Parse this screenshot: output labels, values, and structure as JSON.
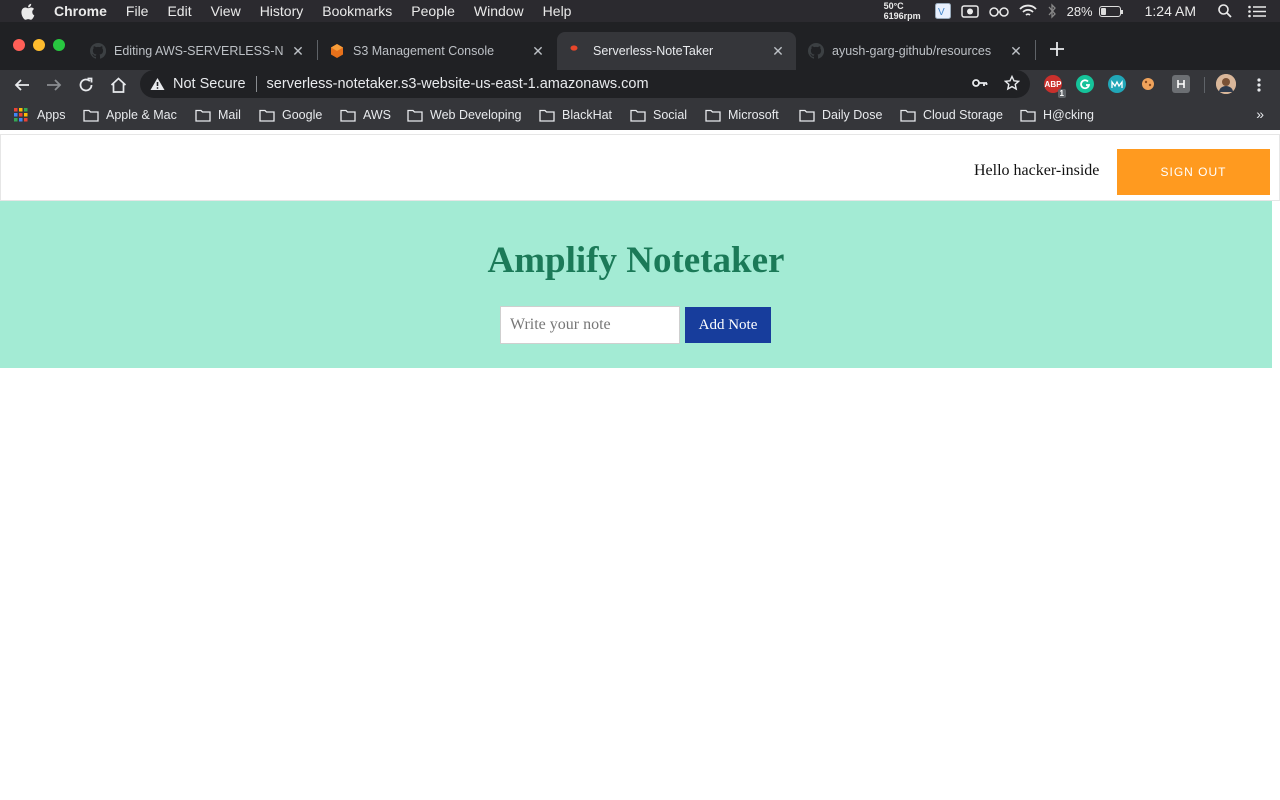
{
  "menubar": {
    "app_name": "Chrome",
    "items": [
      "File",
      "Edit",
      "View",
      "History",
      "Bookmarks",
      "People",
      "Window",
      "Help"
    ],
    "temperature": "50°C",
    "fan_speed": "6196rpm",
    "battery_percent": "28%",
    "battery_level": 0.28,
    "time": "1:24 AM"
  },
  "tabs": [
    {
      "title": "Editing AWS-SERVERLESS-NO",
      "icon": "github-icon",
      "active": false
    },
    {
      "title": "S3 Management Console",
      "icon": "aws-s3-icon",
      "active": false
    },
    {
      "title": "Serverless-NoteTaker",
      "icon": "red-dot-icon",
      "active": true
    },
    {
      "title": "ayush-garg-github/resources",
      "icon": "github-icon",
      "active": false
    }
  ],
  "omnibox": {
    "security_label": "Not Secure",
    "url": "serverless-notetaker.s3-website-us-east-1.amazonaws.com"
  },
  "extensions": {
    "adblock_badge": "1",
    "adblock_label": "ABP"
  },
  "bookmarks": [
    "Apps",
    "Apple & Mac",
    "Mail",
    "Google",
    "AWS",
    "Web Developing",
    "BlackHat",
    "Social",
    "Microsoft",
    "Daily Dose",
    "Cloud Storage",
    "H@cking"
  ],
  "page": {
    "greeting": "Hello hacker-inside",
    "signout_label": "Sign Out",
    "title": "Amplify Notetaker",
    "note_placeholder": "Write your note",
    "add_button": "Add Note"
  },
  "colors": {
    "hero_bg": "#a3ebd4",
    "title_color": "#1b7a58",
    "signout_bg": "#ff9a1f",
    "add_button_bg": "#173d9c"
  }
}
